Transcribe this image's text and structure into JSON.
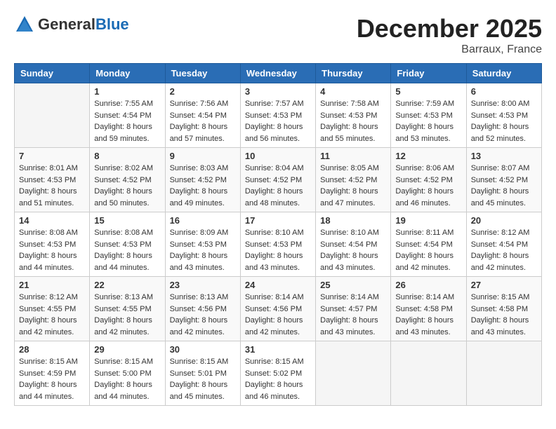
{
  "header": {
    "logo_general": "General",
    "logo_blue": "Blue",
    "month_title": "December 2025",
    "location": "Barraux, France"
  },
  "weekdays": [
    "Sunday",
    "Monday",
    "Tuesday",
    "Wednesday",
    "Thursday",
    "Friday",
    "Saturday"
  ],
  "weeks": [
    [
      {
        "day": "",
        "sunrise": "",
        "sunset": "",
        "daylight": ""
      },
      {
        "day": "1",
        "sunrise": "Sunrise: 7:55 AM",
        "sunset": "Sunset: 4:54 PM",
        "daylight": "Daylight: 8 hours and 59 minutes."
      },
      {
        "day": "2",
        "sunrise": "Sunrise: 7:56 AM",
        "sunset": "Sunset: 4:54 PM",
        "daylight": "Daylight: 8 hours and 57 minutes."
      },
      {
        "day": "3",
        "sunrise": "Sunrise: 7:57 AM",
        "sunset": "Sunset: 4:53 PM",
        "daylight": "Daylight: 8 hours and 56 minutes."
      },
      {
        "day": "4",
        "sunrise": "Sunrise: 7:58 AM",
        "sunset": "Sunset: 4:53 PM",
        "daylight": "Daylight: 8 hours and 55 minutes."
      },
      {
        "day": "5",
        "sunrise": "Sunrise: 7:59 AM",
        "sunset": "Sunset: 4:53 PM",
        "daylight": "Daylight: 8 hours and 53 minutes."
      },
      {
        "day": "6",
        "sunrise": "Sunrise: 8:00 AM",
        "sunset": "Sunset: 4:53 PM",
        "daylight": "Daylight: 8 hours and 52 minutes."
      }
    ],
    [
      {
        "day": "7",
        "sunrise": "Sunrise: 8:01 AM",
        "sunset": "Sunset: 4:53 PM",
        "daylight": "Daylight: 8 hours and 51 minutes."
      },
      {
        "day": "8",
        "sunrise": "Sunrise: 8:02 AM",
        "sunset": "Sunset: 4:52 PM",
        "daylight": "Daylight: 8 hours and 50 minutes."
      },
      {
        "day": "9",
        "sunrise": "Sunrise: 8:03 AM",
        "sunset": "Sunset: 4:52 PM",
        "daylight": "Daylight: 8 hours and 49 minutes."
      },
      {
        "day": "10",
        "sunrise": "Sunrise: 8:04 AM",
        "sunset": "Sunset: 4:52 PM",
        "daylight": "Daylight: 8 hours and 48 minutes."
      },
      {
        "day": "11",
        "sunrise": "Sunrise: 8:05 AM",
        "sunset": "Sunset: 4:52 PM",
        "daylight": "Daylight: 8 hours and 47 minutes."
      },
      {
        "day": "12",
        "sunrise": "Sunrise: 8:06 AM",
        "sunset": "Sunset: 4:52 PM",
        "daylight": "Daylight: 8 hours and 46 minutes."
      },
      {
        "day": "13",
        "sunrise": "Sunrise: 8:07 AM",
        "sunset": "Sunset: 4:52 PM",
        "daylight": "Daylight: 8 hours and 45 minutes."
      }
    ],
    [
      {
        "day": "14",
        "sunrise": "Sunrise: 8:08 AM",
        "sunset": "Sunset: 4:53 PM",
        "daylight": "Daylight: 8 hours and 44 minutes."
      },
      {
        "day": "15",
        "sunrise": "Sunrise: 8:08 AM",
        "sunset": "Sunset: 4:53 PM",
        "daylight": "Daylight: 8 hours and 44 minutes."
      },
      {
        "day": "16",
        "sunrise": "Sunrise: 8:09 AM",
        "sunset": "Sunset: 4:53 PM",
        "daylight": "Daylight: 8 hours and 43 minutes."
      },
      {
        "day": "17",
        "sunrise": "Sunrise: 8:10 AM",
        "sunset": "Sunset: 4:53 PM",
        "daylight": "Daylight: 8 hours and 43 minutes."
      },
      {
        "day": "18",
        "sunrise": "Sunrise: 8:10 AM",
        "sunset": "Sunset: 4:54 PM",
        "daylight": "Daylight: 8 hours and 43 minutes."
      },
      {
        "day": "19",
        "sunrise": "Sunrise: 8:11 AM",
        "sunset": "Sunset: 4:54 PM",
        "daylight": "Daylight: 8 hours and 42 minutes."
      },
      {
        "day": "20",
        "sunrise": "Sunrise: 8:12 AM",
        "sunset": "Sunset: 4:54 PM",
        "daylight": "Daylight: 8 hours and 42 minutes."
      }
    ],
    [
      {
        "day": "21",
        "sunrise": "Sunrise: 8:12 AM",
        "sunset": "Sunset: 4:55 PM",
        "daylight": "Daylight: 8 hours and 42 minutes."
      },
      {
        "day": "22",
        "sunrise": "Sunrise: 8:13 AM",
        "sunset": "Sunset: 4:55 PM",
        "daylight": "Daylight: 8 hours and 42 minutes."
      },
      {
        "day": "23",
        "sunrise": "Sunrise: 8:13 AM",
        "sunset": "Sunset: 4:56 PM",
        "daylight": "Daylight: 8 hours and 42 minutes."
      },
      {
        "day": "24",
        "sunrise": "Sunrise: 8:14 AM",
        "sunset": "Sunset: 4:56 PM",
        "daylight": "Daylight: 8 hours and 42 minutes."
      },
      {
        "day": "25",
        "sunrise": "Sunrise: 8:14 AM",
        "sunset": "Sunset: 4:57 PM",
        "daylight": "Daylight: 8 hours and 43 minutes."
      },
      {
        "day": "26",
        "sunrise": "Sunrise: 8:14 AM",
        "sunset": "Sunset: 4:58 PM",
        "daylight": "Daylight: 8 hours and 43 minutes."
      },
      {
        "day": "27",
        "sunrise": "Sunrise: 8:15 AM",
        "sunset": "Sunset: 4:58 PM",
        "daylight": "Daylight: 8 hours and 43 minutes."
      }
    ],
    [
      {
        "day": "28",
        "sunrise": "Sunrise: 8:15 AM",
        "sunset": "Sunset: 4:59 PM",
        "daylight": "Daylight: 8 hours and 44 minutes."
      },
      {
        "day": "29",
        "sunrise": "Sunrise: 8:15 AM",
        "sunset": "Sunset: 5:00 PM",
        "daylight": "Daylight: 8 hours and 44 minutes."
      },
      {
        "day": "30",
        "sunrise": "Sunrise: 8:15 AM",
        "sunset": "Sunset: 5:01 PM",
        "daylight": "Daylight: 8 hours and 45 minutes."
      },
      {
        "day": "31",
        "sunrise": "Sunrise: 8:15 AM",
        "sunset": "Sunset: 5:02 PM",
        "daylight": "Daylight: 8 hours and 46 minutes."
      },
      {
        "day": "",
        "sunrise": "",
        "sunset": "",
        "daylight": ""
      },
      {
        "day": "",
        "sunrise": "",
        "sunset": "",
        "daylight": ""
      },
      {
        "day": "",
        "sunrise": "",
        "sunset": "",
        "daylight": ""
      }
    ]
  ]
}
